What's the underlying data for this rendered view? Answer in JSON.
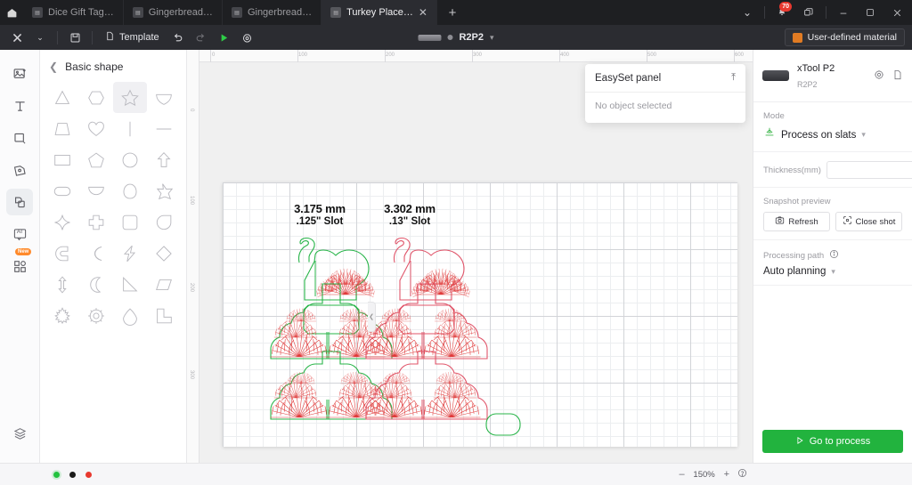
{
  "window": {
    "home_icon": "home-icon",
    "notifications_badge": "70",
    "minimize": "–",
    "maximize": "□",
    "close": "✕"
  },
  "tabs": [
    {
      "label": "Dice Gift Tag…",
      "active": false,
      "icon": "file-icon"
    },
    {
      "label": "Gingerbread…",
      "active": false,
      "icon": "file-icon"
    },
    {
      "label": "Gingerbread…",
      "active": false,
      "icon": "file-icon"
    },
    {
      "label": "Turkey Place…",
      "active": true,
      "icon": "file-icon",
      "close": "✕"
    }
  ],
  "new_tab_label": "+",
  "toolbar": {
    "logo": "xtool-logo-icon",
    "logo_caret": "▾",
    "save_icon": "save-icon",
    "template_label": "Template",
    "template_icon": "document-icon",
    "undo_icon": "undo-icon",
    "redo_icon": "redo-icon",
    "process_icon": "play-icon",
    "camera_icon": "camera-icon",
    "machine_name": "R2P2",
    "machine_caret": "▾",
    "material_label": "User-defined material",
    "material_color": "#e07b23"
  },
  "rail": {
    "items": [
      {
        "name": "image-tool",
        "icon": "image-icon",
        "active": false
      },
      {
        "name": "text-tool",
        "icon": "text-icon",
        "active": false
      },
      {
        "name": "rectangle-tool",
        "icon": "square-icon",
        "active": false
      },
      {
        "name": "draw-tool",
        "icon": "pen-icon",
        "active": false
      },
      {
        "name": "shape-tool",
        "icon": "shapes-icon",
        "active": true
      },
      {
        "name": "ai-tool",
        "icon": "ai-icon",
        "active": false
      },
      {
        "name": "apps-tool",
        "icon": "grid-icon",
        "active": false,
        "badge": "New"
      }
    ],
    "layers_icon": "layers-icon"
  },
  "shapes_panel": {
    "back_icon": "chevron-left-icon",
    "title": "Basic shape",
    "selected_index": 2,
    "shapes": [
      "triangle",
      "hexagon",
      "star",
      "fan",
      "trapezoid",
      "heart",
      "vertical-line",
      "horizontal-line",
      "rectangle",
      "pentagon",
      "circle",
      "arrow-up",
      "stadium",
      "half-circle",
      "egg",
      "six-point-star",
      "four-point-star",
      "cross",
      "rounded-square",
      "teardrop",
      "crescent-c",
      "moon-c",
      "lightning",
      "diamond",
      "double-arrow",
      "crescent-moon",
      "right-triangle",
      "parallelogram",
      "maple-leaf",
      "gear",
      "dome",
      "l-shape"
    ],
    "collapse_icon": "chevron-left-icon"
  },
  "canvas": {
    "zoom": "150%",
    "ruler_h_ticks": [
      "0",
      "100",
      "200",
      "300",
      "400",
      "500",
      "600"
    ],
    "ruler_v_ticks": [
      "0",
      "100",
      "200",
      "300"
    ],
    "labels": [
      {
        "line1": "3.175 mm",
        "line2": ".125\" Slot"
      },
      {
        "line1": "3.302 mm",
        "line2": ".13\" Slot"
      }
    ],
    "stroke_cut": "#28b449",
    "stroke_score": "#e0556a",
    "stroke_engrave": "#e03a3a"
  },
  "easyset": {
    "title": "EasySet panel",
    "collapse_icon": "collapse-icon",
    "empty_text": "No object selected"
  },
  "right_panel": {
    "device_name": "xTool P2",
    "device_model": "R2P2",
    "device_settings_icon": "gear-icon",
    "device_file_icon": "file-icon",
    "mode_label": "Mode",
    "mode_value": "Process on slats",
    "mode_icon": "slats-icon",
    "mode_caret": "▾",
    "thickness_label": "Thickness(mm)",
    "thickness_value": "",
    "thickness_measure_icon": "target-icon",
    "thickness_edit_icon": "pencil-icon",
    "snapshot_label": "Snapshot preview",
    "refresh_label": "Refresh",
    "refresh_icon": "camera-icon",
    "close_shot_label": "Close shot",
    "close_shot_icon": "frame-icon",
    "path_label": "Processing path",
    "path_info_icon": "info-icon",
    "path_value": "Auto planning",
    "path_caret": "▾",
    "go_label": "Go to process",
    "go_icon": "play-icon",
    "go_color": "#22b33e"
  },
  "status_bar": {
    "dots": [
      {
        "name": "status-dot-green",
        "color": "#22c23e"
      },
      {
        "name": "status-dot-black",
        "color": "#1a1a1a"
      },
      {
        "name": "status-dot-red",
        "color": "#e8392f"
      }
    ],
    "zoom_out": "–",
    "zoom_value": "150%",
    "zoom_in": "+",
    "help_icon": "question-icon"
  }
}
